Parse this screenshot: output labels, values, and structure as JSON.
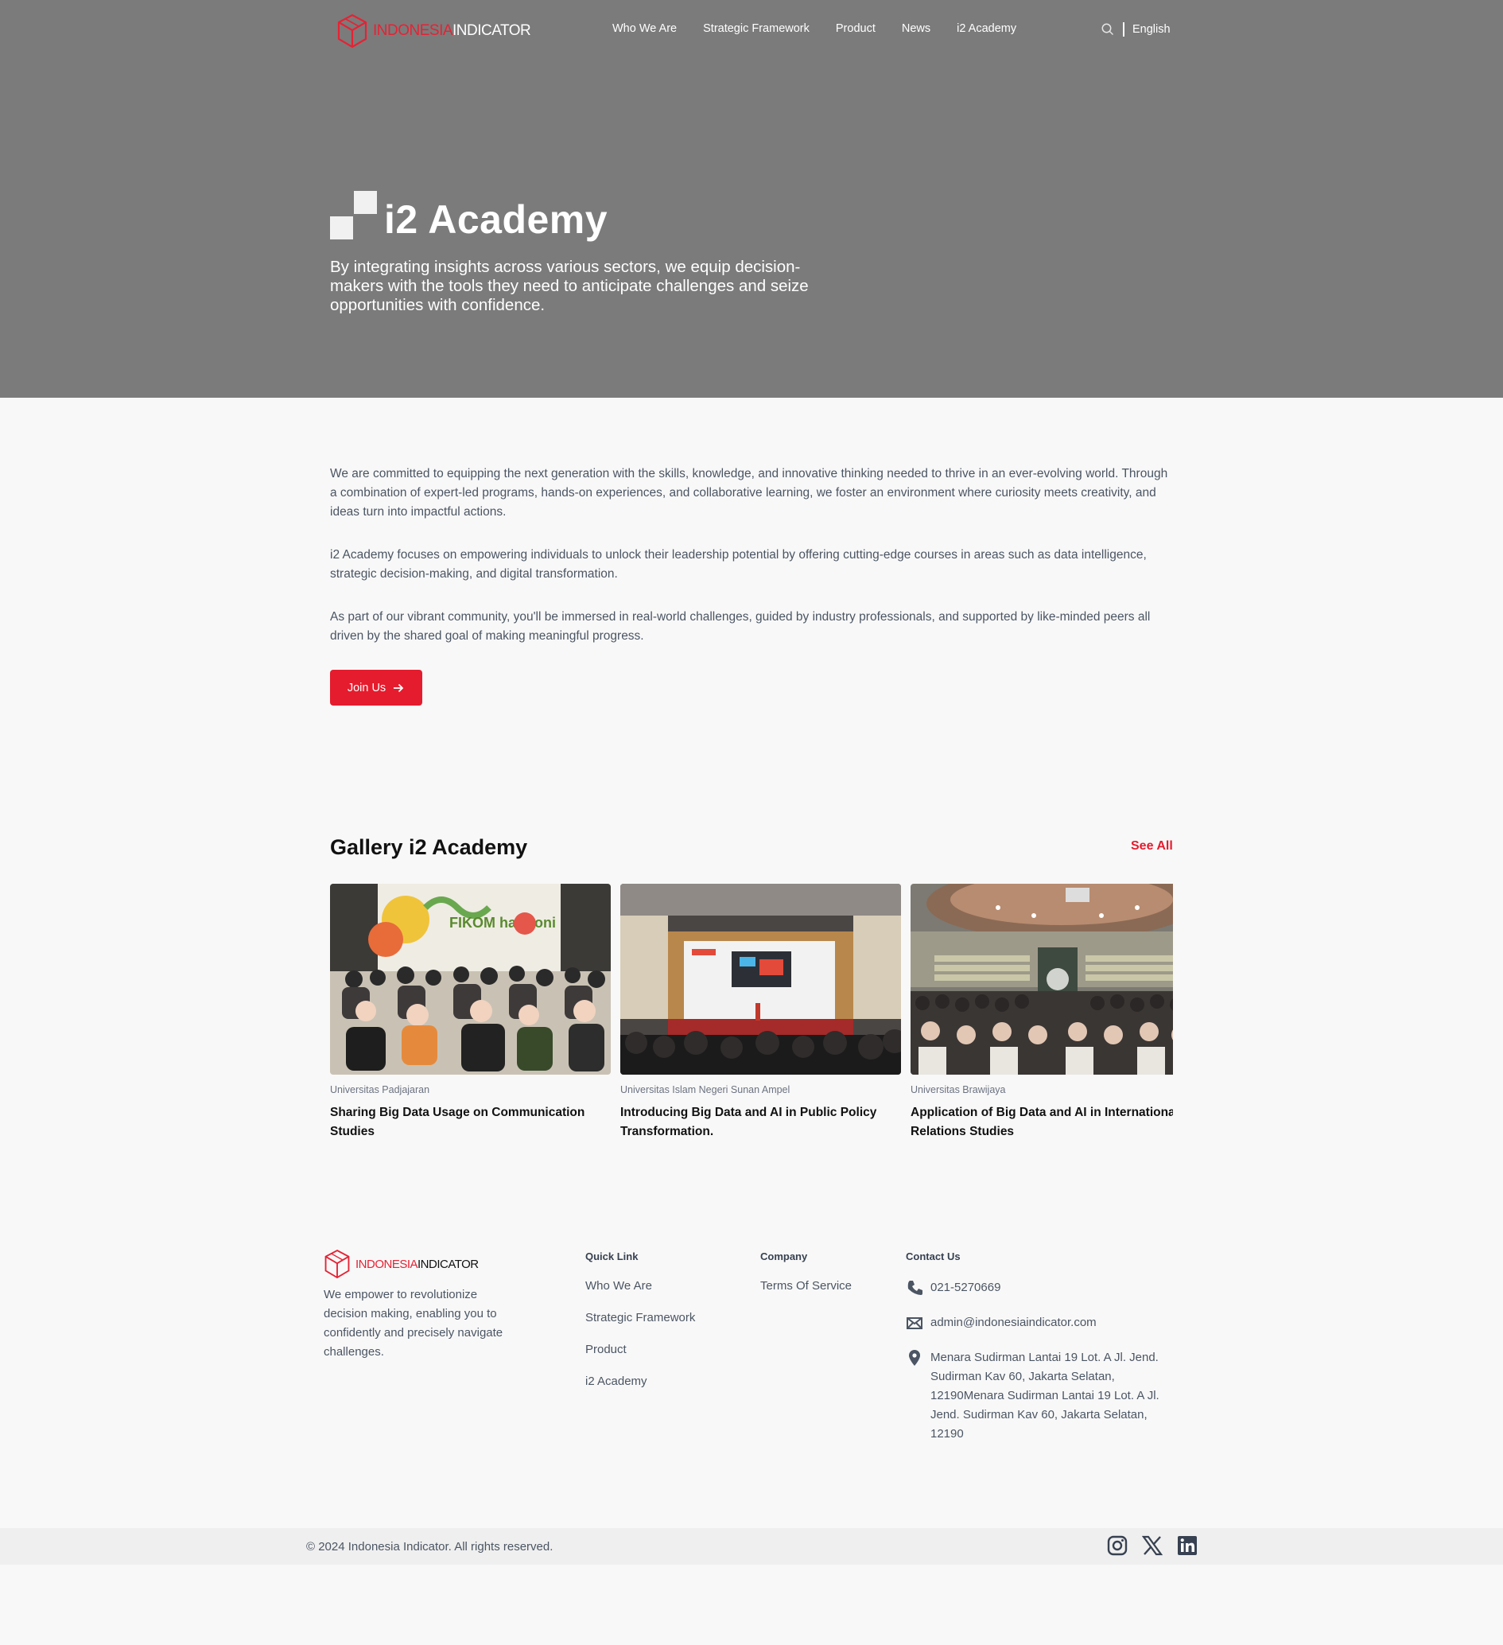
{
  "brand": {
    "name_red": "INDONESIA",
    "name_white": "INDICATOR"
  },
  "nav": {
    "items": [
      {
        "label": "Who We Are"
      },
      {
        "label": "Strategic Framework"
      },
      {
        "label": "Product"
      },
      {
        "label": "News"
      },
      {
        "label": "i2 Academy"
      }
    ],
    "language": "English"
  },
  "hero": {
    "title": "i2 Academy",
    "subtitle": "By integrating insights across various sectors, we equip decision-makers with the tools they need to anticipate challenges and seize opportunities with confidence."
  },
  "intro": {
    "paragraphs": [
      "We are committed to equipping the next generation with the skills, knowledge, and innovative thinking needed to thrive in an ever-evolving world. Through a combination of expert-led programs, hands-on experiences, and collaborative learning, we foster an environment where curiosity meets creativity, and ideas turn into impactful actions.",
      "i2 Academy focuses on empowering individuals to unlock their leadership potential by offering cutting-edge courses in areas such as data intelligence, strategic decision-making, and digital transformation.",
      "As part of our vibrant community, you'll be immersed in real-world challenges, guided by industry professionals, and supported by like-minded peers all driven by the shared goal of making meaningful progress."
    ],
    "join_label": "Join Us"
  },
  "gallery": {
    "title": "Gallery i2 Academy",
    "see_all": "See All",
    "cards": [
      {
        "university": "Universitas Padjajaran",
        "title": "Sharing Big Data Usage on Communication Studies",
        "mural_text": "FIKOM harmoni"
      },
      {
        "university": "Universitas Islam Negeri Sunan Ampel",
        "title": "Introducing Big Data and AI in Public Policy Transformation."
      },
      {
        "university": "Universitas Brawijaya",
        "title": "Application of Big Data and AI in International Relations Studies"
      }
    ]
  },
  "footer": {
    "description": "We empower to revolutionize decision making, enabling you to confidently and precisely navigate challenges.",
    "quick_link": {
      "heading": "Quick Link",
      "items": [
        {
          "label": "Who We Are"
        },
        {
          "label": "Strategic Framework"
        },
        {
          "label": "Product"
        },
        {
          "label": "i2 Academy"
        }
      ]
    },
    "company": {
      "heading": "Company",
      "items": [
        {
          "label": "Terms Of Service"
        }
      ]
    },
    "contact": {
      "heading": "Contact Us",
      "phone": "021-5270669",
      "email": "admin@indonesiaindicator.com",
      "address": "Menara Sudirman Lantai 19 Lot. A Jl. Jend. Sudirman Kav 60, Jakarta Selatan, 12190Menara Sudirman Lantai 19 Lot. A Jl. Jend. Sudirman Kav 60, Jakarta Selatan, 12190"
    },
    "copyright": "© 2024 Indonesia Indicator. All rights reserved.",
    "socials": [
      "instagram-icon",
      "x-icon",
      "linkedin-icon"
    ]
  },
  "colors": {
    "accent": "#e51c2e",
    "hero_bg": "#7b7b7b",
    "bottom_bar": "#efefef"
  }
}
